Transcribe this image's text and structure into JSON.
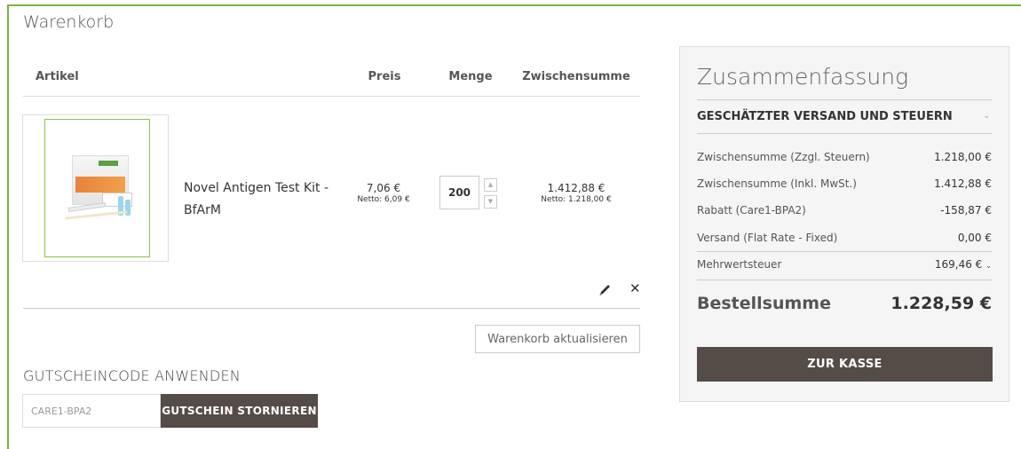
{
  "page": {
    "title": "Warenkorb"
  },
  "cart": {
    "headers": {
      "item": "Artikel",
      "price": "Preis",
      "qty": "Menge",
      "subtotal": "Zwischensumme"
    },
    "items": [
      {
        "name": "Novel Antigen Test Kit - BfArM",
        "image": "product-image",
        "price": "7,06 €",
        "price_net": "Netto: 6,09 €",
        "qty": "200",
        "subtotal": "1.412,88 €",
        "subtotal_net": "Netto: 1.218,00 €"
      }
    ],
    "update_label": "Warenkorb aktualisieren"
  },
  "coupon": {
    "title": "GUTSCHEINCODE ANWENDEN",
    "value": "CARE1-BPA2",
    "cancel_label": "GUTSCHEIN STORNIEREN"
  },
  "summary": {
    "title": "Zusammenfassung",
    "shipping_toggle": "GESCHÄTZTER VERSAND UND STEUERN",
    "rows": [
      {
        "label": "Zwischensumme (Zzgl. Steuern)",
        "value": "1.218,00 €"
      },
      {
        "label": "Zwischensumme (Inkl. MwSt.)",
        "value": "1.412,88 €"
      },
      {
        "label": "Rabatt (Care1-BPA2)",
        "value": "-158,87 €"
      },
      {
        "label": "Versand (Flat Rate - Fixed)",
        "value": "0,00 €"
      },
      {
        "label": "Mehrwertsteuer",
        "value": "169,46 €"
      }
    ],
    "total_label": "Bestellsumme",
    "total_value": "1.228,59 €",
    "checkout_label": "ZUR KASSE"
  },
  "icons": {
    "edit": "pencil-icon",
    "remove": "close-icon",
    "qty_up": "chevron-up-icon",
    "qty_down": "chevron-down-icon",
    "expand": "chevron-down-icon"
  },
  "colors": {
    "frame": "#7cb342",
    "button_bg": "#554b47",
    "panel_bg": "#f5f5f5"
  }
}
